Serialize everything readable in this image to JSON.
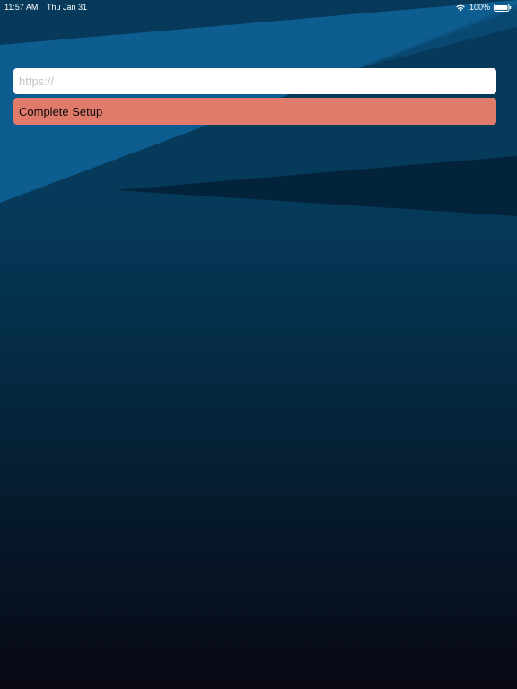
{
  "status_bar": {
    "time": "11:57 AM",
    "date": "Thu Jan 31",
    "battery": "100%",
    "wifi_icon": "wifi-icon",
    "battery_icon": "battery-full-icon"
  },
  "setup": {
    "url_placeholder": "https://",
    "url_value": "",
    "complete_label": "Complete Setup"
  },
  "colors": {
    "button_bg": "#e07a6a",
    "input_bg": "#ffffff",
    "background_top": "#06395a",
    "background_bottom": "#080813"
  }
}
